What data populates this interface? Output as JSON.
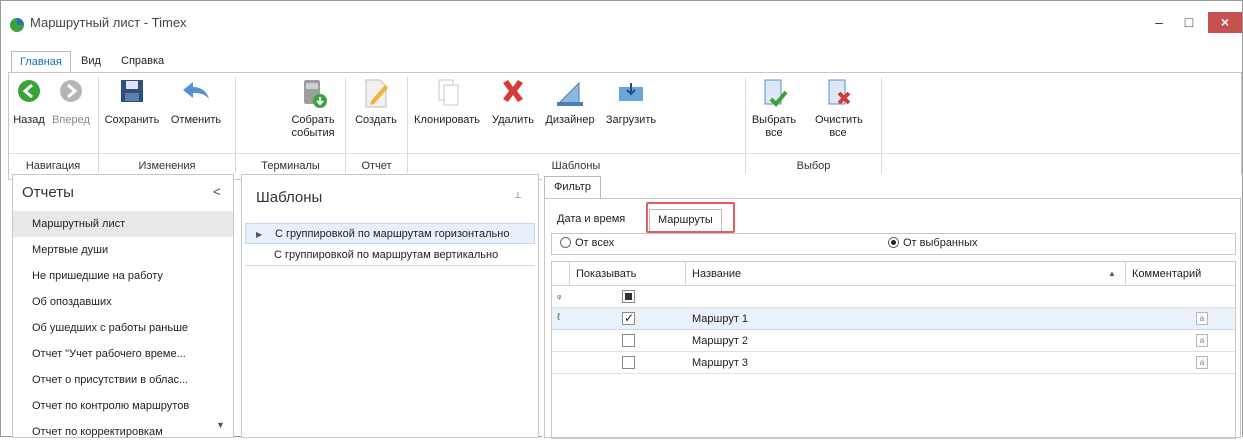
{
  "window": {
    "title": "Маршрутный лист - Timex",
    "min_label": "–",
    "max_label": "□",
    "close_label": "×"
  },
  "menu_tabs": [
    {
      "label": "Главная"
    },
    {
      "label": "Вид"
    },
    {
      "label": "Справка"
    }
  ],
  "ribbon": {
    "buttons": {
      "back": "Назад",
      "forward": "Вперед",
      "save": "Сохранить",
      "cancel": "Отменить",
      "collect": "Собрать события",
      "create": "Создать",
      "clone": "Клонировать",
      "delete": "Удалить",
      "designer": "Дизайнер",
      "load": "Загрузить",
      "select_all": "Выбрать все",
      "clear_all": "Очистить все"
    },
    "groups": {
      "nav": "Навигация",
      "changes": "Изменения",
      "terminals": "Терминалы",
      "report": "Отчет",
      "templates": "Шаблоны",
      "selection": "Выбор"
    }
  },
  "reports": {
    "title": "Отчеты",
    "collapse": "<",
    "scroll_icon": "▼",
    "items": [
      "Маршрутный лист",
      "Мертвые души",
      "Не пришедшие на работу",
      "Об опоздавших",
      "Об ушедших с работы раньше",
      "Отчет \"Учет рабочего време...",
      "Отчет о присутствии в облас...",
      "Отчет по контролю маршрутов",
      "Отчет по корректировкам"
    ]
  },
  "templates": {
    "title": "Шаблоны",
    "pin": "⊥",
    "items": [
      "С группировкой по маршрутам горизонтально",
      "С группировкой по маршрутам вертикально"
    ]
  },
  "filter": {
    "tab": "Фильтр",
    "subtabs": {
      "datetime": "Дата и время",
      "routes": "Маршруты"
    },
    "radio_all": "От всех",
    "radio_selected": "От выбранных",
    "grid": {
      "headers": {
        "show": "Показывать",
        "name": "Название",
        "comment": "Комментарий",
        "sort": "▲"
      },
      "rows": [
        {
          "name": "Маршрут 1",
          "checked": true
        },
        {
          "name": "Маршрут 2",
          "checked": false
        },
        {
          "name": "Маршрут 3",
          "checked": false
        }
      ],
      "filter_row_icon": "ᵩ",
      "edit_row_icon": "ℓ",
      "check_mark": "✓",
      "memo_icon": "a"
    }
  }
}
